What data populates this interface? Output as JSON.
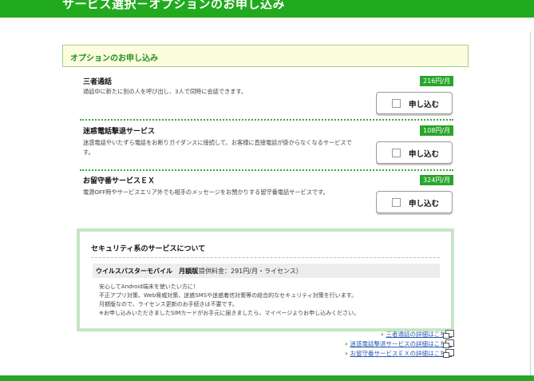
{
  "header": {
    "title": "サービス選択－オプションのお申し込み"
  },
  "section": {
    "title": "オプションのお申し込み"
  },
  "options": [
    {
      "name": "三者通話",
      "price": "216円/月",
      "description": "通話中に新たに別の人を呼び出し、3人で同時に会話できます。",
      "button_label": "申し込む"
    },
    {
      "name": "迷惑電話撃退サービス",
      "price": "108円/月",
      "description": "迷惑電話やいたずら電話をお断りガイダンスに接続して、お客様に直接電話が掛からなくなるサービスで",
      "description_cont": "す。",
      "button_label": "申し込む"
    },
    {
      "name": "お留守番サービスＥＸ",
      "price": "324円/月",
      "description": "電源OFF時やサービスエリア外でも相手のメッセージをお預かりする留守番電話サービスです。",
      "button_label": "申し込む"
    }
  ],
  "security": {
    "title": "セキュリティ系のサービスについて",
    "product_name": "ウイルスバスターモバイル　月額版",
    "product_price": "（提供料金：291円/月・ライセンス）",
    "lines": [
      "安心してAndroid端末を使いたい方に！",
      "不正アプリ対策、Web脅威対策、迷惑SMSや迷惑着信対策等の総合的なセキュリティ対策を行います。",
      "月額版なので、ライセンス更新のお手続きは不要です。",
      "※お申し込みいただきましたSIMカードがお手元に届きましたら、マイページよりお申し込みください。"
    ]
  },
  "links": [
    "三者通話の詳細はこちら",
    "迷惑電話撃退サービスの詳細はこちら",
    "お留守番サービスＥＸの詳細はこちら"
  ],
  "colors": {
    "brand_green": "#22aa1e",
    "section_bg": "#fbfddd",
    "link": "#2b5bb0"
  }
}
